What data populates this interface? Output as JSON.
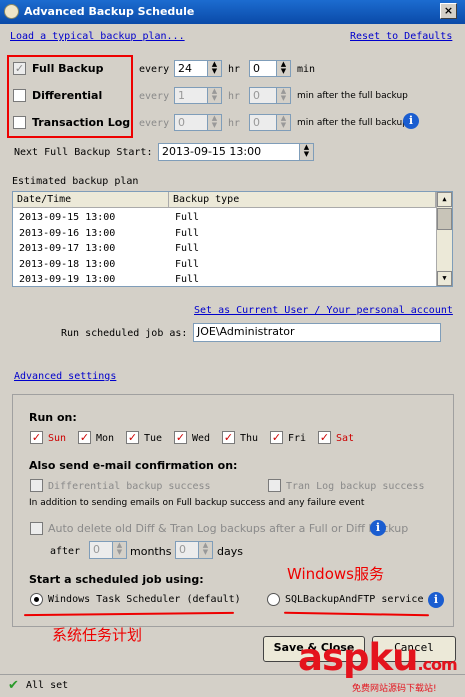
{
  "window": {
    "title": "Advanced Backup Schedule",
    "close_glyph": "×"
  },
  "top_links": {
    "load": "Load a typical backup plan...",
    "reset": "Reset to Defaults"
  },
  "schedule": {
    "full": {
      "label": "Full Backup",
      "every": "every",
      "hr_value": "24",
      "hr": "hr",
      "min_value": "0",
      "min": "min"
    },
    "diff": {
      "label": "Differential",
      "every": "every",
      "hr_value": "1",
      "hr": "hr",
      "min_value": "0",
      "min": "min after the full backup"
    },
    "tlog": {
      "label": "Transaction Log",
      "every": "every",
      "hr_value": "0",
      "hr": "hr",
      "min_value": "0",
      "min": "min after the full backup"
    }
  },
  "next_start": {
    "label": "Next Full Backup Start:",
    "value": "2013-09-15 13:00"
  },
  "plan": {
    "label": "Estimated backup plan",
    "columns": [
      "Date/Time",
      "Backup type"
    ],
    "rows": [
      [
        "2013-09-15 13:00",
        "Full"
      ],
      [
        "2013-09-16 13:00",
        "Full"
      ],
      [
        "2013-09-17 13:00",
        "Full"
      ],
      [
        "2013-09-18 13:00",
        "Full"
      ],
      [
        "2013-09-19 13:00",
        "Full"
      ]
    ]
  },
  "run_as": {
    "set_link": "Set as Current User / Your personal account",
    "label": "Run scheduled job as:",
    "value": "JOE\\Administrator"
  },
  "advanced": {
    "link": "Advanced settings",
    "run_on": "Run on:",
    "days": [
      "Sun",
      "Mon",
      "Tue",
      "Wed",
      "Thu",
      "Fri",
      "Sat"
    ],
    "email_heading": "Also send e-mail confirmation on:",
    "diff_success": "Differential backup success",
    "tlog_success": "Tran Log backup success",
    "email_note": "In addition to sending emails on Full backup success and any failure event",
    "auto_delete": "Auto delete old Diff & Tran Log backups after a Full or Diff backup",
    "after": "after",
    "months_value": "0",
    "months": "months",
    "days_value": "0",
    "days_label": "days",
    "start_heading": "Start a scheduled job using:",
    "task_scheduler": "Windows Task Scheduler (default)",
    "service": "SQLBackupAndFTP service"
  },
  "annotations": {
    "service_cn": "Windows服务",
    "scheduler_cn": "系统任务计划"
  },
  "buttons": {
    "save": "Save & Close",
    "cancel": "Cancel"
  },
  "status": {
    "text": "All set"
  },
  "watermark": {
    "main": "aspku",
    "dot": ".com",
    "sub": "免费网站源码下载站!"
  }
}
